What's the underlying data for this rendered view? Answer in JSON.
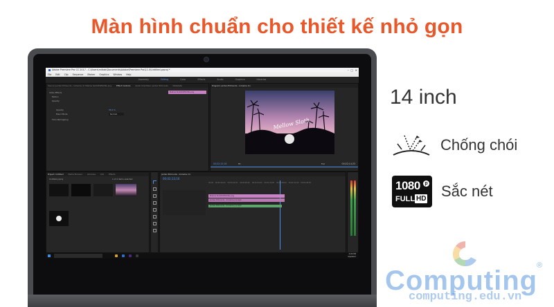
{
  "headline": "Màn hình chuẩn cho thiết kế nhỏ gọn",
  "features": {
    "size": "14 inch",
    "anti_glare_label": "Chống chói",
    "anti_glare_icon": "anti-glare-icon",
    "sharp_label": "Sắc nét",
    "badge_1080": "1080",
    "badge_p": "p",
    "badge_full": "FULL",
    "badge_hd": "HD"
  },
  "screen": {
    "title": "Adobe Premiere Pro CC 2017 - C:\\Users\\mitlab\\Documents\\Adobe\\Premiere Pro\\11.0\\Untitled.prproj *",
    "menu": [
      "File",
      "Edit",
      "Clip",
      "Sequence",
      "Marker",
      "Graphics",
      "Window",
      "Help"
    ],
    "workspaces": [
      "Assembly",
      "Editing",
      "Color",
      "Effects",
      "Audio",
      "Graphics",
      "Libraries"
    ],
    "source_tabs": [
      "Source: Jordan Edmunds - Inmeme (1) Mellow Slo0d0VPOCNL.png",
      "Effect Controls",
      "Audio Clip Mixer: Jordan Edmunds",
      "Metadata"
    ],
    "program_tab": "Program: Jordan Edmunds - Inmeme (1)",
    "fx_rows": [
      "Video Effects",
      "Motion",
      "Opacity",
      "Opacity",
      "Blend Mode",
      "Time Remapping"
    ],
    "opacity_value": "55.0 %",
    "blend_value": "Normal",
    "clip_name": "Mellow Slo0d0VPOCNL.png",
    "program_timecode": "00;02;13;16",
    "program_duration": "00;02;14;33",
    "fit_label": "Fit",
    "full_label": "Full",
    "project_tabs": [
      "Project: Untitled",
      "Media Browser",
      "Libraries",
      "Info",
      "Effects"
    ],
    "project_file": "Untitled.prproj",
    "project_count": "1 of 4 items selected",
    "timeline_tab": "Jordan Edmunds - Inmeme (1)",
    "timeline_timecode": "00;02;13;16",
    "ruler": [
      "00;00",
      "00;00;16;00",
      "00;00;32;00",
      "00;00;48;00",
      "00;01;04;00",
      "00;01;20;00",
      "00;01;36;00",
      "00;01;52;00",
      "00;02;08;00"
    ],
    "clip_track1": "Mellow Slo0d0VPOCNL.png",
    "clip_track2": "Jordan Edmunds - Inmeme (1).mp4",
    "clip_track3": "Jordan Edmunds - Inmeme (1).mp4",
    "clock_time": "4:00 PM",
    "clock_date": "5/4/2017"
  },
  "watermark": {
    "text": "Computing",
    "reg": "®",
    "url": "computing.edu.vn"
  },
  "colors": {
    "headline": "#e8582b",
    "watermark": "#4d8edb",
    "accent_blue": "#4f93e8",
    "clip_pink": "#c883c4",
    "clip_green": "#5fa56b"
  }
}
